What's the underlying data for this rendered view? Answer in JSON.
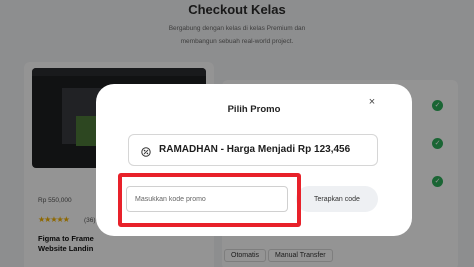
{
  "page": {
    "title": "Checkout Kelas",
    "subtitle_line1": "Bergabung dengan kelas di kelas Premium dan",
    "subtitle_line2": "membangun sebuah real-world project."
  },
  "course": {
    "title_line1": "Figma to Frame",
    "title_line2": "Website Landin",
    "price": "Rp 550,000",
    "stars": "★★★★★",
    "rating_count": "(36)"
  },
  "payment_tabs": [
    "Otomatis",
    "Manual Transfer"
  ],
  "modal": {
    "title": "Pilih Promo",
    "close_glyph": "×",
    "selected_promo": "RAMADHAN - Harga Menjadi Rp 123,456",
    "code_input_placeholder": "Masukkan kode promo",
    "code_input_value": "",
    "apply_label": "Terapkan code"
  },
  "colors": {
    "highlight": "#e8212a",
    "check": "#2eaf5b",
    "star": "#f5b400"
  },
  "icons": {
    "promo_tag": "tag-icon",
    "close": "close-icon",
    "check": "check-circle-icon"
  }
}
